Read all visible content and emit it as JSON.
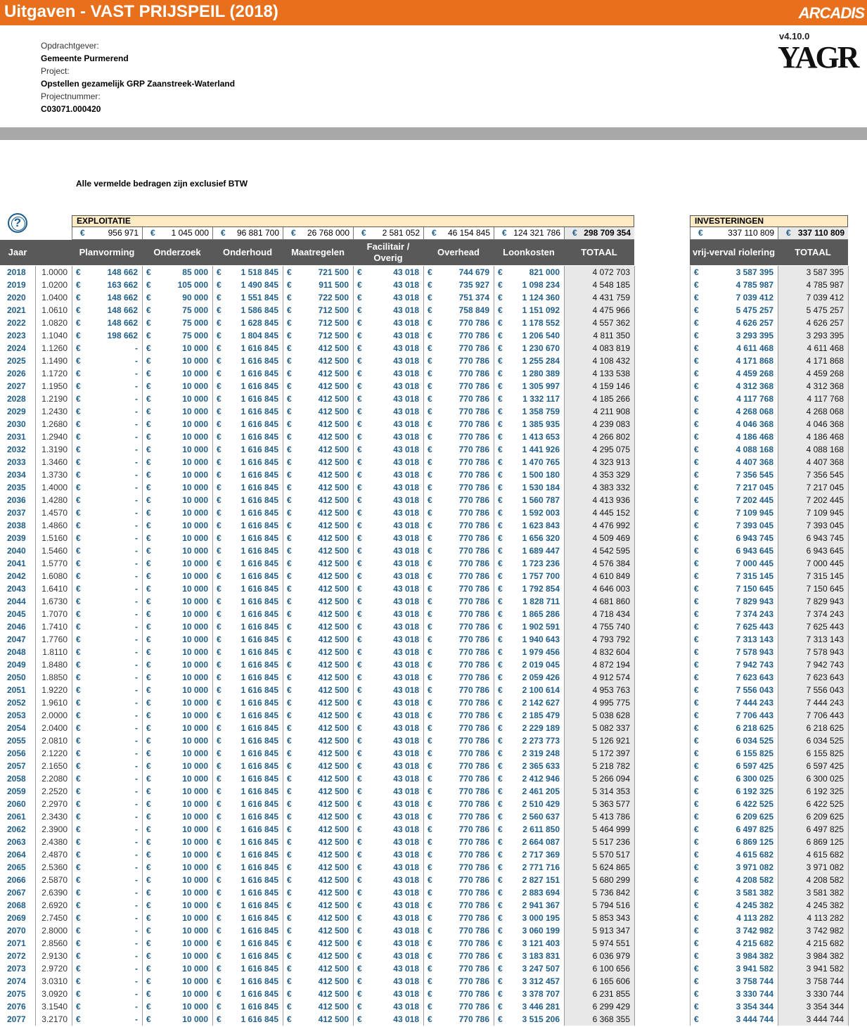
{
  "header": {
    "title": "Uitgaven - VAST PRIJSPEIL (2018)",
    "brand": "ARCADIS",
    "version": "v4.10.0",
    "product": "YAGR"
  },
  "project": {
    "client_label": "Opdrachtgever:",
    "client": "Gemeente Purmerend",
    "project_label": "Project:",
    "project": "Opstellen gezamelijk GRP Zaanstreek-Waterland",
    "number_label": "Projectnummer:",
    "number": "C03071.000420"
  },
  "note": "Alle vermelde bedragen zijn exclusief BTW",
  "help_icon": "?",
  "currency": "€",
  "exploitatie": {
    "title": "EXPLOITATIE",
    "sums": [
      "956 971",
      "1 045 000",
      "96 881 700",
      "26 768 000",
      "2 581 052",
      "46 154 845",
      "124 321 786"
    ],
    "total": "298 709 354"
  },
  "investeringen": {
    "title": "INVESTERINGEN",
    "sum": "337 110 809",
    "total": "337 110 809"
  },
  "columns": {
    "jaar": "Jaar",
    "planvorming": "Planvorming",
    "onderzoek": "Onderzoek",
    "onderhoud": "Onderhoud",
    "maatregelen": "Maatregelen",
    "facilitair": "Facilitair / Overig",
    "overhead": "Overhead",
    "loonkosten": "Loonkosten",
    "totaal": "TOTAAL",
    "vrijverval": "vrij-verval riolering",
    "totaal2": "TOTAAL"
  },
  "rows": [
    [
      "2018",
      "1.0000",
      "148 662",
      "85 000",
      "1 518 845",
      "721 500",
      "43 018",
      "744 679",
      "821 000",
      "4 072 703",
      "3 587 395",
      "3 587 395"
    ],
    [
      "2019",
      "1.0200",
      "163 662",
      "105 000",
      "1 490 845",
      "911 500",
      "43 018",
      "735 927",
      "1 098 234",
      "4 548 185",
      "4 785 987",
      "4 785 987"
    ],
    [
      "2020",
      "1.0400",
      "148 662",
      "90 000",
      "1 551 845",
      "722 500",
      "43 018",
      "751 374",
      "1 124 360",
      "4 431 759",
      "7 039 412",
      "7 039 412"
    ],
    [
      "2021",
      "1.0610",
      "148 662",
      "75 000",
      "1 586 845",
      "712 500",
      "43 018",
      "758 849",
      "1 151 092",
      "4 475 966",
      "5 475 257",
      "5 475 257"
    ],
    [
      "2022",
      "1.0820",
      "148 662",
      "75 000",
      "1 628 845",
      "712 500",
      "43 018",
      "770 786",
      "1 178 552",
      "4 557 362",
      "4 626 257",
      "4 626 257"
    ],
    [
      "2023",
      "1.1040",
      "198 662",
      "75 000",
      "1 804 845",
      "712 500",
      "43 018",
      "770 786",
      "1 206 540",
      "4 811 350",
      "3 293 395",
      "3 293 395"
    ],
    [
      "2024",
      "1.1260",
      "-",
      "10 000",
      "1 616 845",
      "412 500",
      "43 018",
      "770 786",
      "1 230 670",
      "4 083 819",
      "4 611 468",
      "4 611 468"
    ],
    [
      "2025",
      "1.1490",
      "-",
      "10 000",
      "1 616 845",
      "412 500",
      "43 018",
      "770 786",
      "1 255 284",
      "4 108 432",
      "4 171 868",
      "4 171 868"
    ],
    [
      "2026",
      "1.1720",
      "-",
      "10 000",
      "1 616 845",
      "412 500",
      "43 018",
      "770 786",
      "1 280 389",
      "4 133 538",
      "4 459 268",
      "4 459 268"
    ],
    [
      "2027",
      "1.1950",
      "-",
      "10 000",
      "1 616 845",
      "412 500",
      "43 018",
      "770 786",
      "1 305 997",
      "4 159 146",
      "4 312 368",
      "4 312 368"
    ],
    [
      "2028",
      "1.2190",
      "-",
      "10 000",
      "1 616 845",
      "412 500",
      "43 018",
      "770 786",
      "1 332 117",
      "4 185 266",
      "4 117 768",
      "4 117 768"
    ],
    [
      "2029",
      "1.2430",
      "-",
      "10 000",
      "1 616 845",
      "412 500",
      "43 018",
      "770 786",
      "1 358 759",
      "4 211 908",
      "4 268 068",
      "4 268 068"
    ],
    [
      "2030",
      "1.2680",
      "-",
      "10 000",
      "1 616 845",
      "412 500",
      "43 018",
      "770 786",
      "1 385 935",
      "4 239 083",
      "4 046 368",
      "4 046 368"
    ],
    [
      "2031",
      "1.2940",
      "-",
      "10 000",
      "1 616 845",
      "412 500",
      "43 018",
      "770 786",
      "1 413 653",
      "4 266 802",
      "4 186 468",
      "4 186 468"
    ],
    [
      "2032",
      "1.3190",
      "-",
      "10 000",
      "1 616 845",
      "412 500",
      "43 018",
      "770 786",
      "1 441 926",
      "4 295 075",
      "4 088 168",
      "4 088 168"
    ],
    [
      "2033",
      "1.3460",
      "-",
      "10 000",
      "1 616 845",
      "412 500",
      "43 018",
      "770 786",
      "1 470 765",
      "4 323 913",
      "4 407 368",
      "4 407 368"
    ],
    [
      "2034",
      "1.3730",
      "-",
      "10 000",
      "1 616 845",
      "412 500",
      "43 018",
      "770 786",
      "1 500 180",
      "4 353 329",
      "7 356 545",
      "7 356 545"
    ],
    [
      "2035",
      "1.4000",
      "-",
      "10 000",
      "1 616 845",
      "412 500",
      "43 018",
      "770 786",
      "1 530 184",
      "4 383 332",
      "7 217 045",
      "7 217 045"
    ],
    [
      "2036",
      "1.4280",
      "-",
      "10 000",
      "1 616 845",
      "412 500",
      "43 018",
      "770 786",
      "1 560 787",
      "4 413 936",
      "7 202 445",
      "7 202 445"
    ],
    [
      "2037",
      "1.4570",
      "-",
      "10 000",
      "1 616 845",
      "412 500",
      "43 018",
      "770 786",
      "1 592 003",
      "4 445 152",
      "7 109 945",
      "7 109 945"
    ],
    [
      "2038",
      "1.4860",
      "-",
      "10 000",
      "1 616 845",
      "412 500",
      "43 018",
      "770 786",
      "1 623 843",
      "4 476 992",
      "7 393 045",
      "7 393 045"
    ],
    [
      "2039",
      "1.5160",
      "-",
      "10 000",
      "1 616 845",
      "412 500",
      "43 018",
      "770 786",
      "1 656 320",
      "4 509 469",
      "6 943 745",
      "6 943 745"
    ],
    [
      "2040",
      "1.5460",
      "-",
      "10 000",
      "1 616 845",
      "412 500",
      "43 018",
      "770 786",
      "1 689 447",
      "4 542 595",
      "6 943 645",
      "6 943 645"
    ],
    [
      "2041",
      "1.5770",
      "-",
      "10 000",
      "1 616 845",
      "412 500",
      "43 018",
      "770 786",
      "1 723 236",
      "4 576 384",
      "7 000 445",
      "7 000 445"
    ],
    [
      "2042",
      "1.6080",
      "-",
      "10 000",
      "1 616 845",
      "412 500",
      "43 018",
      "770 786",
      "1 757 700",
      "4 610 849",
      "7 315 145",
      "7 315 145"
    ],
    [
      "2043",
      "1.6410",
      "-",
      "10 000",
      "1 616 845",
      "412 500",
      "43 018",
      "770 786",
      "1 792 854",
      "4 646 003",
      "7 150 645",
      "7 150 645"
    ],
    [
      "2044",
      "1.6730",
      "-",
      "10 000",
      "1 616 845",
      "412 500",
      "43 018",
      "770 786",
      "1 828 711",
      "4 681 860",
      "7 829 943",
      "7 829 943"
    ],
    [
      "2045",
      "1.7070",
      "-",
      "10 000",
      "1 616 845",
      "412 500",
      "43 018",
      "770 786",
      "1 865 286",
      "4 718 434",
      "7 374 243",
      "7 374 243"
    ],
    [
      "2046",
      "1.7410",
      "-",
      "10 000",
      "1 616 845",
      "412 500",
      "43 018",
      "770 786",
      "1 902 591",
      "4 755 740",
      "7 625 443",
      "7 625 443"
    ],
    [
      "2047",
      "1.7760",
      "-",
      "10 000",
      "1 616 845",
      "412 500",
      "43 018",
      "770 786",
      "1 940 643",
      "4 793 792",
      "7 313 143",
      "7 313 143"
    ],
    [
      "2048",
      "1.8110",
      "-",
      "10 000",
      "1 616 845",
      "412 500",
      "43 018",
      "770 786",
      "1 979 456",
      "4 832 604",
      "7 578 943",
      "7 578 943"
    ],
    [
      "2049",
      "1.8480",
      "-",
      "10 000",
      "1 616 845",
      "412 500",
      "43 018",
      "770 786",
      "2 019 045",
      "4 872 194",
      "7 942 743",
      "7 942 743"
    ],
    [
      "2050",
      "1.8850",
      "-",
      "10 000",
      "1 616 845",
      "412 500",
      "43 018",
      "770 786",
      "2 059 426",
      "4 912 574",
      "7 623 643",
      "7 623 643"
    ],
    [
      "2051",
      "1.9220",
      "-",
      "10 000",
      "1 616 845",
      "412 500",
      "43 018",
      "770 786",
      "2 100 614",
      "4 953 763",
      "7 556 043",
      "7 556 043"
    ],
    [
      "2052",
      "1.9610",
      "-",
      "10 000",
      "1 616 845",
      "412 500",
      "43 018",
      "770 786",
      "2 142 627",
      "4 995 775",
      "7 444 243",
      "7 444 243"
    ],
    [
      "2053",
      "2.0000",
      "-",
      "10 000",
      "1 616 845",
      "412 500",
      "43 018",
      "770 786",
      "2 185 479",
      "5 038 628",
      "7 706 443",
      "7 706 443"
    ],
    [
      "2054",
      "2.0400",
      "-",
      "10 000",
      "1 616 845",
      "412 500",
      "43 018",
      "770 786",
      "2 229 189",
      "5 082 337",
      "6 218 625",
      "6 218 625"
    ],
    [
      "2055",
      "2.0810",
      "-",
      "10 000",
      "1 616 845",
      "412 500",
      "43 018",
      "770 786",
      "2 273 773",
      "5 126 921",
      "6 034 525",
      "6 034 525"
    ],
    [
      "2056",
      "2.1220",
      "-",
      "10 000",
      "1 616 845",
      "412 500",
      "43 018",
      "770 786",
      "2 319 248",
      "5 172 397",
      "6 155 825",
      "6 155 825"
    ],
    [
      "2057",
      "2.1650",
      "-",
      "10 000",
      "1 616 845",
      "412 500",
      "43 018",
      "770 786",
      "2 365 633",
      "5 218 782",
      "6 597 425",
      "6 597 425"
    ],
    [
      "2058",
      "2.2080",
      "-",
      "10 000",
      "1 616 845",
      "412 500",
      "43 018",
      "770 786",
      "2 412 946",
      "5 266 094",
      "6 300 025",
      "6 300 025"
    ],
    [
      "2059",
      "2.2520",
      "-",
      "10 000",
      "1 616 845",
      "412 500",
      "43 018",
      "770 786",
      "2 461 205",
      "5 314 353",
      "6 192 325",
      "6 192 325"
    ],
    [
      "2060",
      "2.2970",
      "-",
      "10 000",
      "1 616 845",
      "412 500",
      "43 018",
      "770 786",
      "2 510 429",
      "5 363 577",
      "6 422 525",
      "6 422 525"
    ],
    [
      "2061",
      "2.3430",
      "-",
      "10 000",
      "1 616 845",
      "412 500",
      "43 018",
      "770 786",
      "2 560 637",
      "5 413 786",
      "6 209 625",
      "6 209 625"
    ],
    [
      "2062",
      "2.3900",
      "-",
      "10 000",
      "1 616 845",
      "412 500",
      "43 018",
      "770 786",
      "2 611 850",
      "5 464 999",
      "6 497 825",
      "6 497 825"
    ],
    [
      "2063",
      "2.4380",
      "-",
      "10 000",
      "1 616 845",
      "412 500",
      "43 018",
      "770 786",
      "2 664 087",
      "5 517 236",
      "6 869 125",
      "6 869 125"
    ],
    [
      "2064",
      "2.4870",
      "-",
      "10 000",
      "1 616 845",
      "412 500",
      "43 018",
      "770 786",
      "2 717 369",
      "5 570 517",
      "4 615 682",
      "4 615 682"
    ],
    [
      "2065",
      "2.5360",
      "-",
      "10 000",
      "1 616 845",
      "412 500",
      "43 018",
      "770 786",
      "2 771 716",
      "5 624 865",
      "3 971 082",
      "3 971 082"
    ],
    [
      "2066",
      "2.5870",
      "-",
      "10 000",
      "1 616 845",
      "412 500",
      "43 018",
      "770 786",
      "2 827 151",
      "5 680 299",
      "4 208 582",
      "4 208 582"
    ],
    [
      "2067",
      "2.6390",
      "-",
      "10 000",
      "1 616 845",
      "412 500",
      "43 018",
      "770 786",
      "2 883 694",
      "5 736 842",
      "3 581 382",
      "3 581 382"
    ],
    [
      "2068",
      "2.6920",
      "-",
      "10 000",
      "1 616 845",
      "412 500",
      "43 018",
      "770 786",
      "2 941 367",
      "5 794 516",
      "4 245 382",
      "4 245 382"
    ],
    [
      "2069",
      "2.7450",
      "-",
      "10 000",
      "1 616 845",
      "412 500",
      "43 018",
      "770 786",
      "3 000 195",
      "5 853 343",
      "4 113 282",
      "4 113 282"
    ],
    [
      "2070",
      "2.8000",
      "-",
      "10 000",
      "1 616 845",
      "412 500",
      "43 018",
      "770 786",
      "3 060 199",
      "5 913 347",
      "3 742 982",
      "3 742 982"
    ],
    [
      "2071",
      "2.8560",
      "-",
      "10 000",
      "1 616 845",
      "412 500",
      "43 018",
      "770 786",
      "3 121 403",
      "5 974 551",
      "4 215 682",
      "4 215 682"
    ],
    [
      "2072",
      "2.9130",
      "-",
      "10 000",
      "1 616 845",
      "412 500",
      "43 018",
      "770 786",
      "3 183 831",
      "6 036 979",
      "3 984 382",
      "3 984 382"
    ],
    [
      "2073",
      "2.9720",
      "-",
      "10 000",
      "1 616 845",
      "412 500",
      "43 018",
      "770 786",
      "3 247 507",
      "6 100 656",
      "3 941 582",
      "3 941 582"
    ],
    [
      "2074",
      "3.0310",
      "-",
      "10 000",
      "1 616 845",
      "412 500",
      "43 018",
      "770 786",
      "3 312 457",
      "6 165 606",
      "3 758 744",
      "3 758 744"
    ],
    [
      "2075",
      "3.0920",
      "-",
      "10 000",
      "1 616 845",
      "412 500",
      "43 018",
      "770 786",
      "3 378 707",
      "6 231 855",
      "3 330 744",
      "3 330 744"
    ],
    [
      "2076",
      "3.1540",
      "-",
      "10 000",
      "1 616 845",
      "412 500",
      "43 018",
      "770 786",
      "3 446 281",
      "6 299 429",
      "3 354 344",
      "3 354 344"
    ],
    [
      "2077",
      "3.2170",
      "-",
      "10 000",
      "1 616 845",
      "412 500",
      "43 018",
      "770 786",
      "3 515 206",
      "6 368 355",
      "3 444 744",
      "3 444 744"
    ]
  ]
}
